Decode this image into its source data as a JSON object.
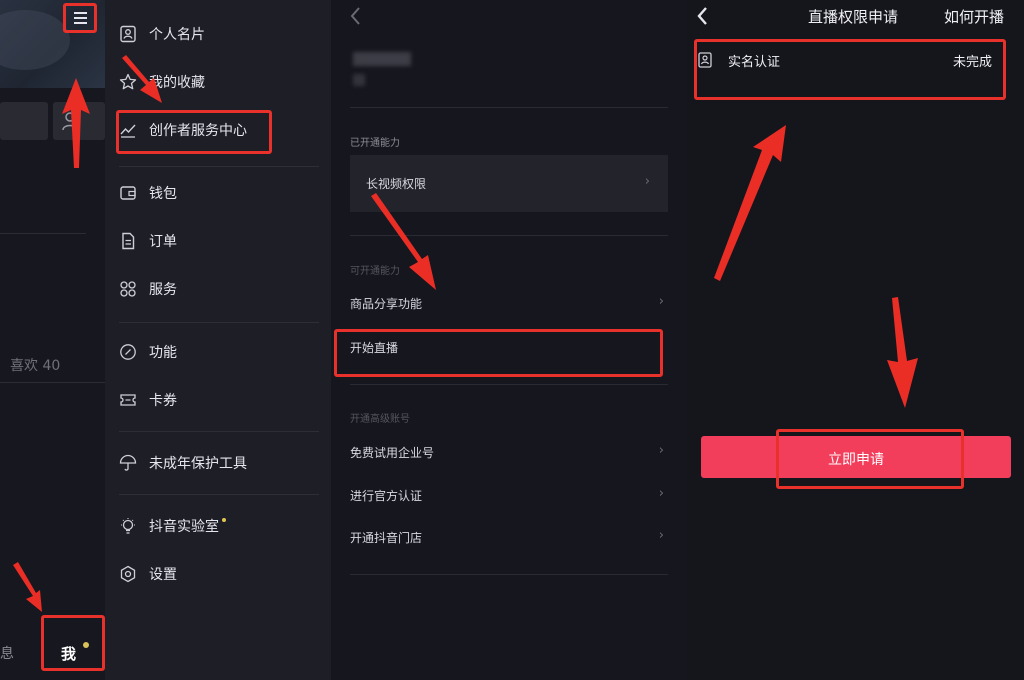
{
  "profile_panel": {
    "likes_text": "喜欢 40",
    "nav_partial": "息",
    "me_label": "我"
  },
  "side_menu": {
    "items": [
      {
        "label": "个人名片",
        "icon": "id-card-icon"
      },
      {
        "label": "我的收藏",
        "icon": "star-icon"
      },
      {
        "label": "创作者服务中心",
        "icon": "chart-line-icon"
      },
      {
        "label": "钱包",
        "icon": "wallet-icon"
      },
      {
        "label": "订单",
        "icon": "order-icon"
      },
      {
        "label": "服务",
        "icon": "grid-icon"
      },
      {
        "label": "功能",
        "icon": "link-icon"
      },
      {
        "label": "卡券",
        "icon": "coupon-icon"
      },
      {
        "label": "未成年保护工具",
        "icon": "umbrella-icon"
      },
      {
        "label": "抖音实验室",
        "icon": "bulb-icon"
      },
      {
        "label": "设置",
        "icon": "gear-icon"
      }
    ]
  },
  "abilities_panel": {
    "opened_header": "已开通能力",
    "long_video": "长视频权限",
    "available_header": "可开通能力",
    "product_share": "商品分享功能",
    "start_live": "开始直播",
    "advanced_header": "开通高级账号",
    "enterprise": "免费试用企业号",
    "official_cert": "进行官方认证",
    "store": "开通抖音门店",
    "chevron": "›"
  },
  "live_panel": {
    "title": "直播权限申请",
    "how_to": "如何开播",
    "real_name": "实名认证",
    "status": "未完成",
    "apply": "立即申请"
  },
  "colors": {
    "highlight": "#e8312a",
    "apply_button": "#f23d5b",
    "lab_dot": "#e3c44e"
  }
}
